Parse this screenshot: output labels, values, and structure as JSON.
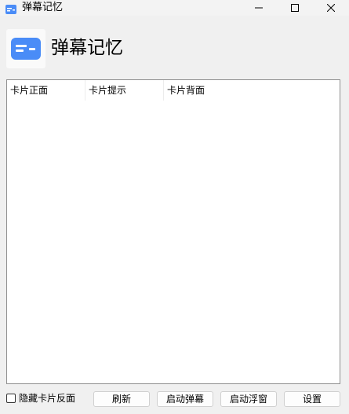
{
  "window": {
    "title": "弹幕记忆"
  },
  "header": {
    "title": "弹幕记忆",
    "logo_icon": "chat-bubble-icon",
    "accent_color": "#4a8cf7"
  },
  "table": {
    "columns": [
      "卡片正面",
      "卡片提示",
      "卡片背面"
    ],
    "rows": []
  },
  "footer": {
    "hide_back_label": "隐藏卡片反面",
    "hide_back_checked": false,
    "refresh_label": "刷新",
    "start_danmaku_label": "启动弹幕",
    "start_float_label": "启动浮窗",
    "settings_label": "设置"
  }
}
